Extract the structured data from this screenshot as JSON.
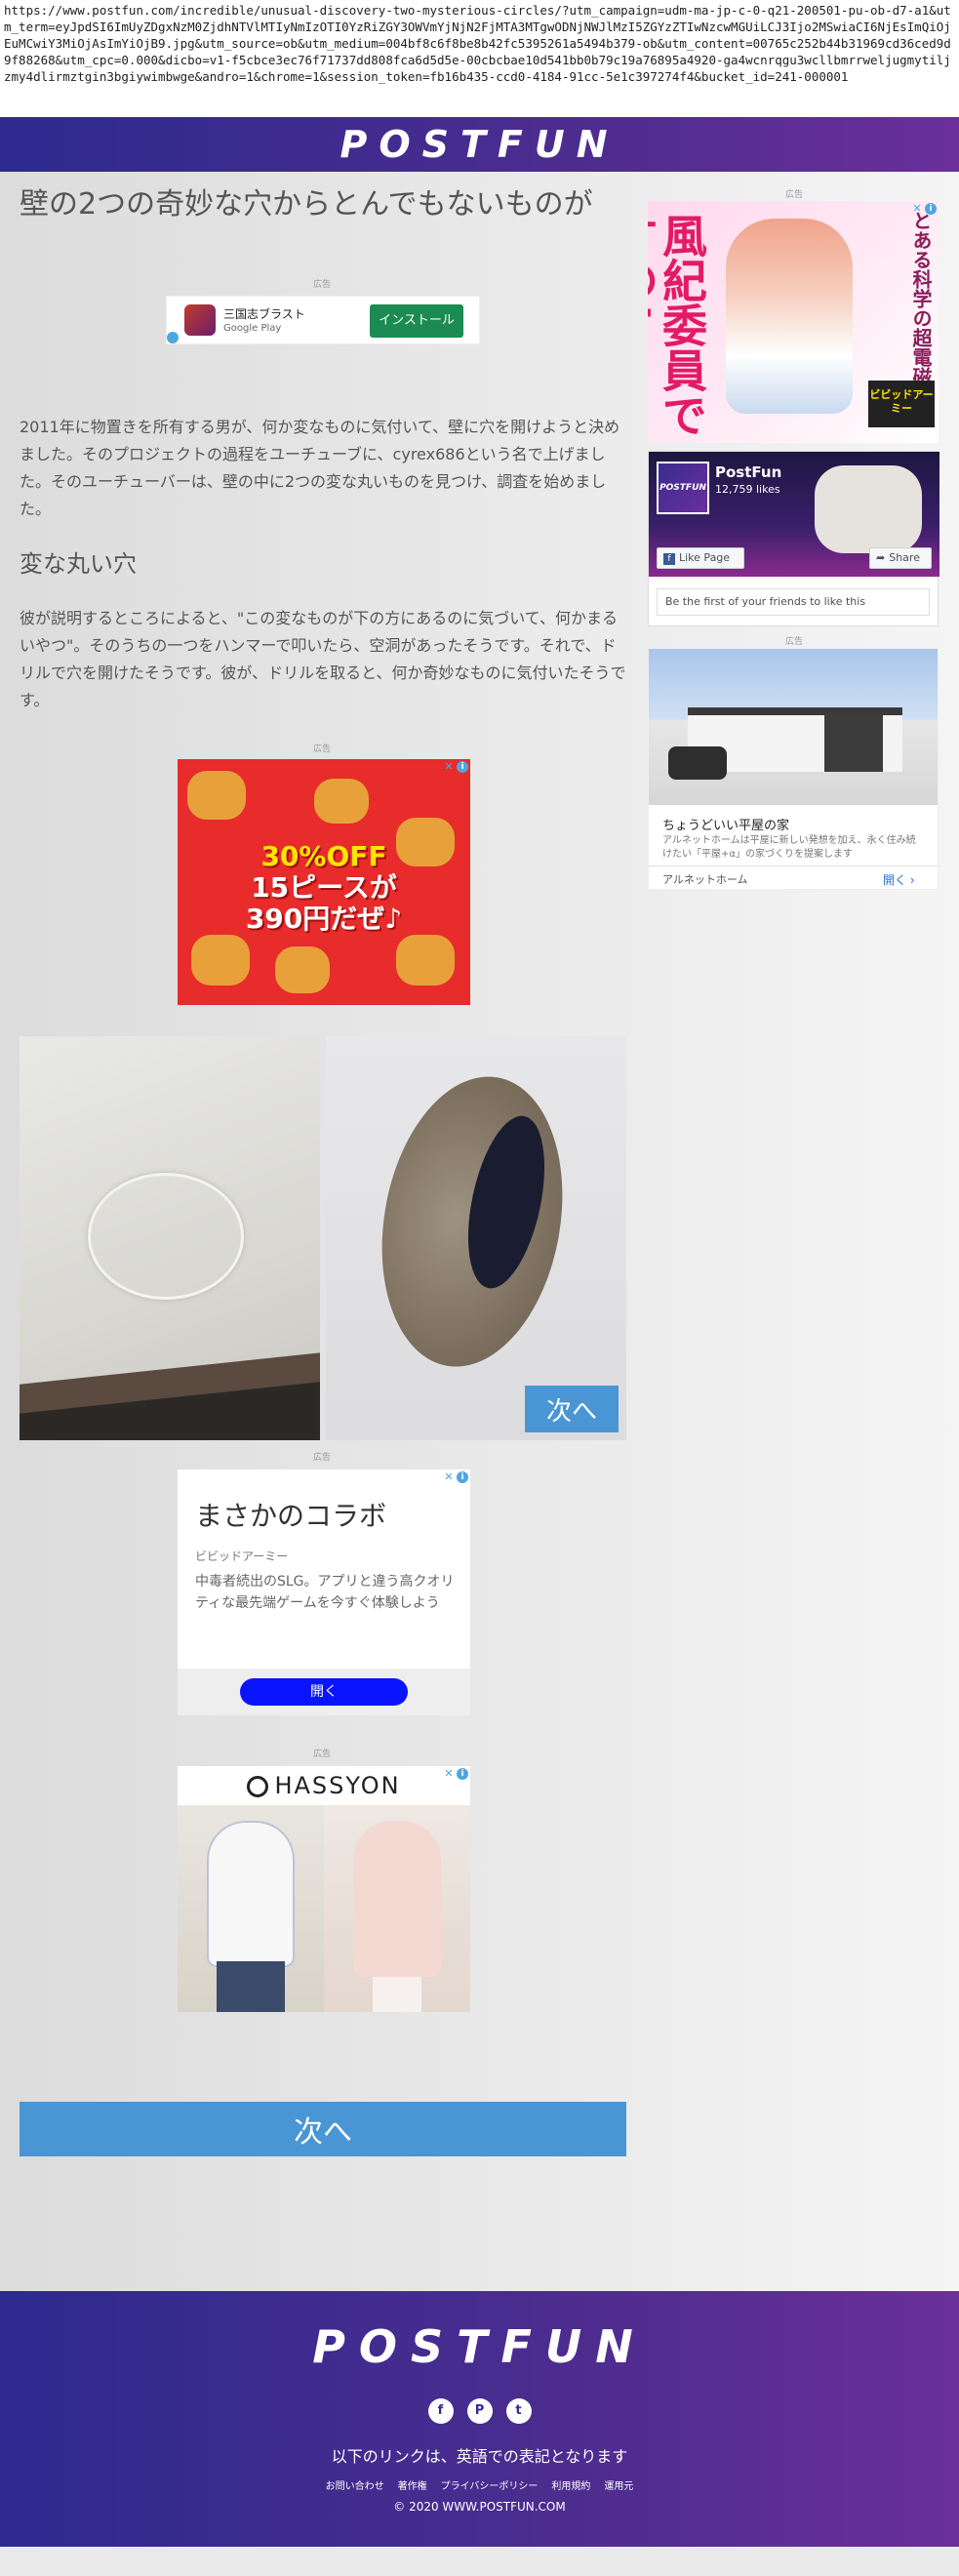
{
  "url": "https://www.postfun.com/incredible/unusual-discovery-two-mysterious-circles/?utm_campaign=udm-ma-jp-c-0-q21-200501-pu-ob-d7-a1&utm_term=eyJpdSI6ImUyZDgxNzM0ZjdhNTVlMTIyNmIzOTI0YzRiZGY3OWVmYjNjN2FjMTA3MTgwODNjNWJlMzI5ZGYzZTIwNzcwMGUiLCJ3Ijo2MSwiaCI6NjEsImQiOjEuMCwiY3MiOjAsImYiOjB9.jpg&utm_source=ob&utm_medium=004bf8c6f8be8b42fc5395261a5494b379-ob&utm_content=00765c252b44b31969cd36ced9d9f88268&utm_cpc=0.000&dicbo=v1-f5cbce3ec76f71737dd808fca6d5d5e-00cbcbae10d541bb0b79c19a76895a4920-ga4wcnrqgu3wcllbmrrweljugmytiljzmy4dlirmztgin3bgiywimbwge&andro=1&chrome=1&session_token=fb16b435-ccd0-4184-91cc-5e1c397274f4&bucket_id=241-000001",
  "site": {
    "logo": "POSTFUN"
  },
  "article": {
    "title": "壁の2つの奇妙な穴からとんでもないものが",
    "para1": "2011年に物置きを所有する男が、何か変なものに気付いて、壁に穴を開けようと決めました。そのプロジェクトの過程をユーチューブに、cyrex686という名で上げました。そのユーチューバーは、壁の中に2つの変な丸いものを見つけ、調査を始めました。",
    "h2": "変な丸い穴",
    "para2": "彼が説明するところによると、\"この変なものが下の方にあるのに気づいて、何かまるいやつ\"。そのうちの一つをハンマーで叩いたら、空洞があったそうです。それで、ドリルで穴を開けたそうです。彼が、ドリルを取ると、何か奇妙なものに気付いたそうです。",
    "next_label": "次へ",
    "next_big_label": "次へ"
  },
  "ads": {
    "label": "広告",
    "app_ad": {
      "title": "三国志ブラスト",
      "store": "Google Play",
      "cta": "インストール"
    },
    "food_ad": {
      "line1": "30%OFF",
      "line2": "15ピースが",
      "line3": "390円だぜ♪"
    },
    "game_ad": {
      "title": "まさかのコラボ",
      "brand": "ビビッドアーミー",
      "body": "中毒者続出のSLG。アプリと違う高クオリティな最先端ゲームを今すぐ体験しよう",
      "cta": "開く"
    },
    "fashion_ad": {
      "brand": "HASSYON"
    },
    "manga_ad": {
      "title": "風紀委員ですの!",
      "sub": "とある科学の超電磁砲",
      "corner": "ビビッドアーミー"
    },
    "house_ad": {
      "title": "ちょうどいい平屋の家",
      "body": "アルネットホームは平屋に新しい発想を加え、永く住み続けたい「平屋+α」の家づくりを提案します",
      "brand": "アルネットホーム",
      "cta": "開く"
    }
  },
  "facebook": {
    "page": "PostFun",
    "likes": "12,759 likes",
    "like_btn": "Like Page",
    "share_btn": "Share",
    "first": "Be the first of your friends to like this"
  },
  "footer": {
    "logo": "POSTFUN",
    "note": "以下のリンクは、英語での表記となります",
    "links": [
      "お問い合わせ",
      "著作権",
      "プライバシーポリシー",
      "利用規約",
      "運用元"
    ],
    "copyright": "© 2020 WWW.POSTFUN.COM"
  },
  "colors": {
    "header": "#3b2c90",
    "next_button": "#4a96d4"
  }
}
